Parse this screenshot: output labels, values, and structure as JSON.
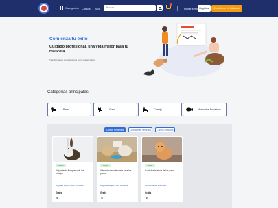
{
  "header": {
    "categories_label": "Categorías",
    "nav": [
      "Cursos",
      "Blog"
    ],
    "search_placeholder": "Buscar...",
    "login": "Iniciar sesión",
    "register": "Registrar",
    "cta": "Conviértete en Educador"
  },
  "hero": {
    "title": "Comienza tu éxito",
    "subtitle": "Cuidado profesional, una vida mejor para tu mascota",
    "description": "Transforma tus conocimientos sobre los animales"
  },
  "categories": {
    "title": "Categorías principales",
    "items": [
      {
        "label": "Perro",
        "icon": "dog-icon"
      },
      {
        "label": "Gato",
        "icon": "cat-icon"
      },
      {
        "label": "Conejo",
        "icon": "rabbit-icon"
      },
      {
        "label": "Animales Acuáticos",
        "icon": "fish-icon"
      }
    ]
  },
  "products": {
    "tabs": [
      "Cursos Recientes",
      "Cursos más Vendidos",
      "Cursos Gratuitos"
    ],
    "cards": [
      {
        "badge": "Conejo",
        "title": "Alojamiento Apropiado de los conejos",
        "author": "Brigidaa Reyes Paco Fonseek",
        "price": "Gratis",
        "image": "rabbit"
      },
      {
        "badge": "Conejo",
        "title": "Alimentación adecuada para los perros",
        "author": "Brigidaa Reyes Paco Fonseek",
        "price": "Gratis",
        "image": "dogs"
      },
      {
        "badge": "Gato",
        "title": "Cuidados básicos de los gatos",
        "author": "Academia del Educador",
        "price": "Gratis",
        "image": "cat"
      }
    ]
  },
  "colors": {
    "header_bg": "#1f2f6b",
    "accent_blue": "#2e6fd1",
    "cta_orange": "#f39c12"
  }
}
